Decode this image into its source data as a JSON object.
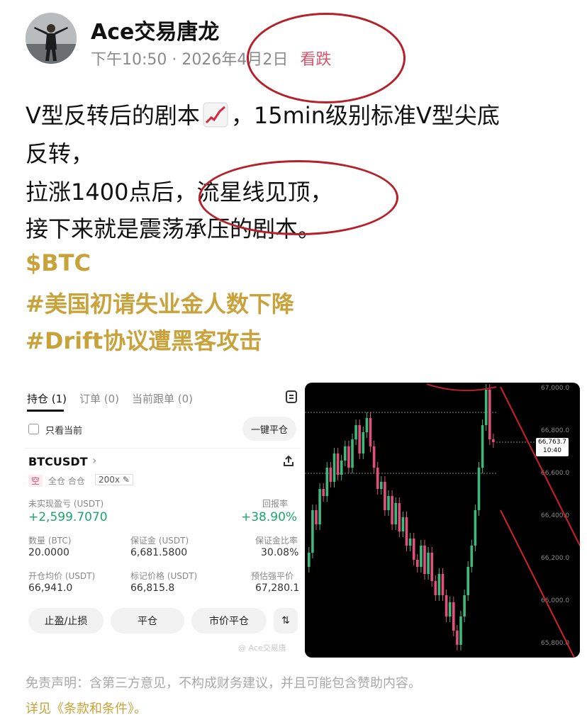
{
  "author": {
    "name": "Ace交易唐龙"
  },
  "meta": {
    "time": "下午10:50",
    "sep": "·",
    "date": "2026年4月2日",
    "sentiment": "看跌"
  },
  "post": {
    "line1": "V型反转后的剧本",
    "line1_tail": "，15min级别标准V型尖底",
    "line2": "反转，",
    "line3": "拉涨1400点后，流星线见顶，",
    "line4": "接下来就是震荡承压的剧本。",
    "tags": [
      "$BTC",
      "#美国初请失业金人数下降",
      "#Drift协议遭黑客攻击"
    ]
  },
  "positions": {
    "tabs": [
      "持仓 (1)",
      "订单 (0)",
      "当前跟单 (0)"
    ],
    "only_current": "只看当前",
    "close_all": "一键平仓",
    "symbol": "BTCUSDT",
    "badge_short": "空",
    "margin_mode": "全仓 合仓",
    "leverage": "200x",
    "upnl_label": "未实现盈亏 (USDT)",
    "upnl_value": "+2,599.7070",
    "roi_label": "回报率",
    "roi_value": "+38.90%",
    "qty_label": "数量 (BTC)",
    "qty_value": "20.0000",
    "margin_label": "保证金 (USDT)",
    "margin_value": "6,681.5800",
    "margin_ratio_label": "保证金比率",
    "margin_ratio_value": "30.08%",
    "entry_label": "开仓均价 (USDT)",
    "entry_value": "66,941.0",
    "mark_label": "标记价格 (USDT)",
    "mark_value": "66,815.8",
    "liq_label": "预估强平价",
    "liq_value": "67,280.1",
    "btn_tpsl": "止盈/止损",
    "btn_close": "平仓",
    "btn_market_close": "市价平仓",
    "watermark": "@ Ace交易唐"
  },
  "chart_data": {
    "type": "candlestick",
    "yticks": [
      "67,000.0",
      "66,800.0",
      "66,600.0",
      "66,400.0",
      "66,200.0",
      "66,000.0",
      "65,800.0"
    ],
    "price_label": "66,763.7",
    "time_label": "10:40",
    "up_color": "#3fb97a",
    "down_color": "#e0507a"
  },
  "disclaimer": "免责声明：含第三方意见，不构成财务建议，并且可能包含赞助内容。",
  "terms": "详见《条款和条件》。"
}
